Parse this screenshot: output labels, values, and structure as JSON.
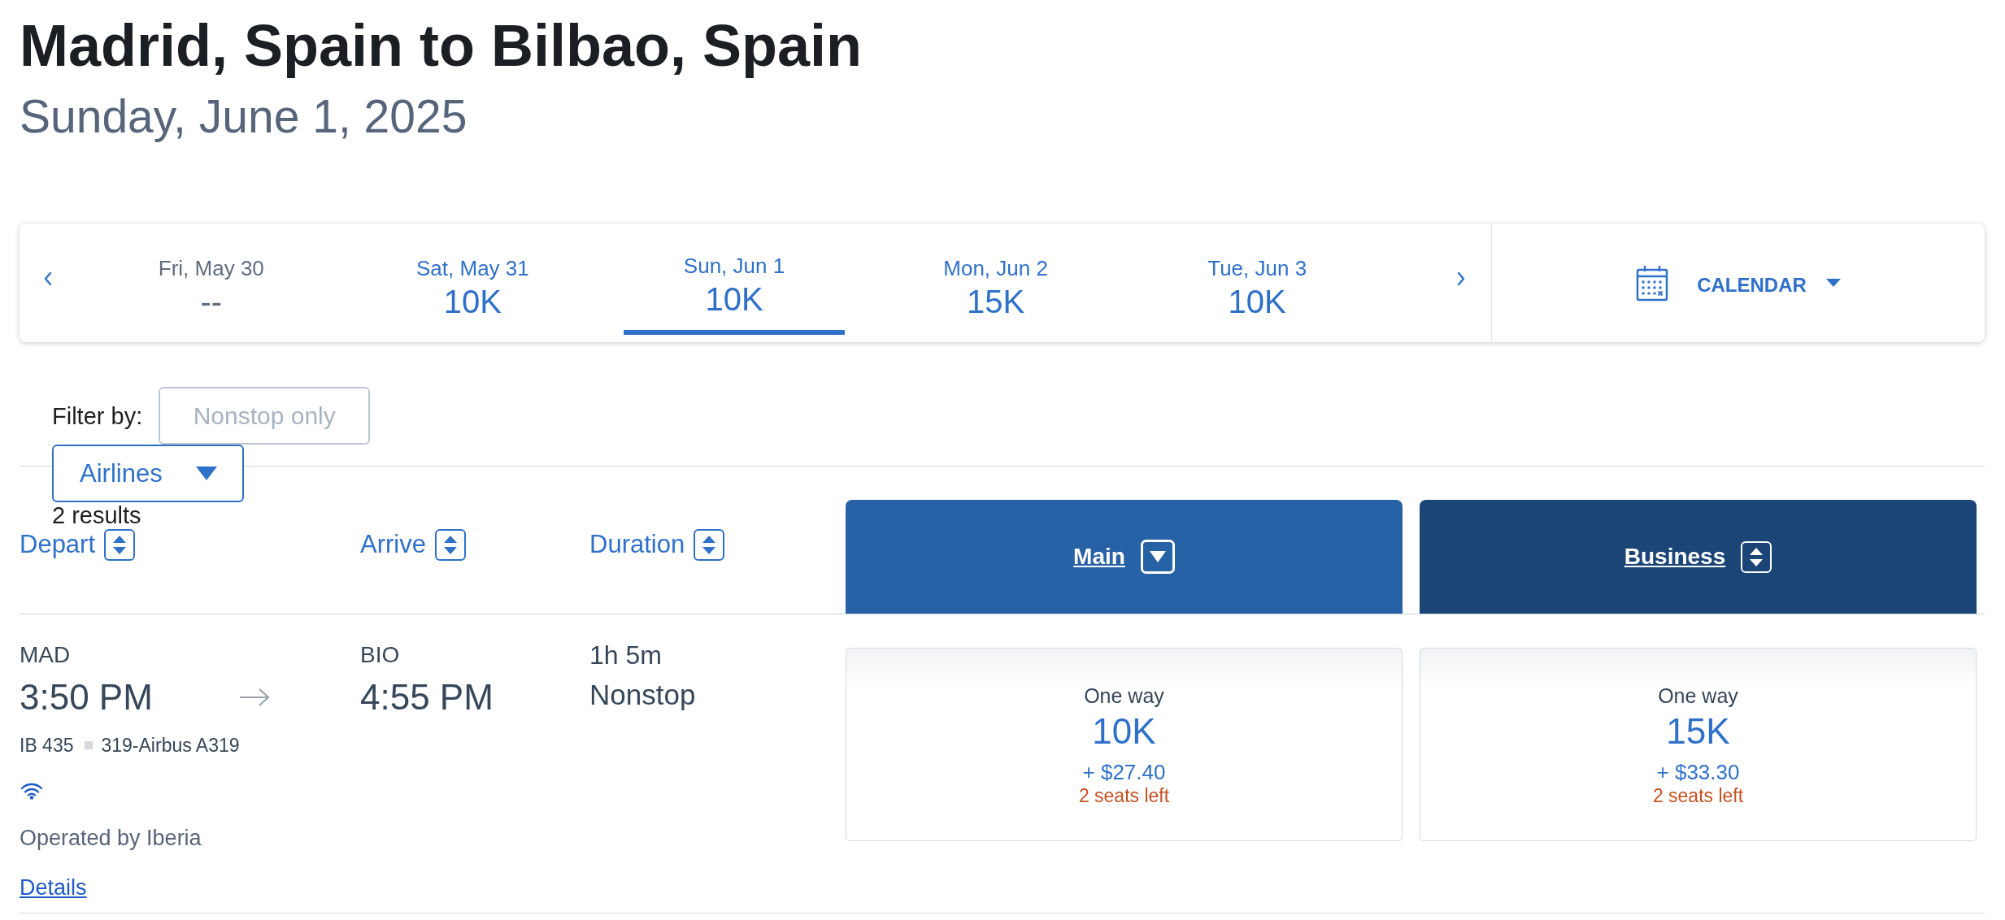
{
  "header": {
    "title": "Madrid, Spain to Bilbao, Spain",
    "subtitle": "Sunday, June 1, 2025"
  },
  "date_strip": {
    "days": [
      {
        "label": "Fri, May 30",
        "price": "--",
        "selected": false,
        "disabled": true
      },
      {
        "label": "Sat, May 31",
        "price": "10K",
        "selected": false,
        "disabled": false
      },
      {
        "label": "Sun, Jun 1",
        "price": "10K",
        "selected": true,
        "disabled": false
      },
      {
        "label": "Mon, Jun 2",
        "price": "15K",
        "selected": false,
        "disabled": false
      },
      {
        "label": "Tue, Jun 3",
        "price": "10K",
        "selected": false,
        "disabled": false
      }
    ],
    "calendar_button": {
      "label": "CALENDAR"
    }
  },
  "filters": {
    "label": "Filter by:",
    "nonstop": {
      "label": "Nonstop only",
      "disabled": true
    },
    "airlines": {
      "label": "Airlines"
    },
    "result_count": "2 results"
  },
  "columns": [
    {
      "label": "Depart"
    },
    {
      "label": "Arrive"
    },
    {
      "label": "Duration"
    }
  ],
  "cabins": [
    {
      "label": "Main",
      "sorted": true
    },
    {
      "label": "Business",
      "sorted": false
    }
  ],
  "flights": [
    {
      "depart": {
        "airport": "MAD",
        "time": "3:50 PM"
      },
      "arrive": {
        "airport": "BIO",
        "time": "4:55 PM"
      },
      "duration": "1h 5m",
      "stops": "Nonstop",
      "flight_number": "IB 435",
      "aircraft": "319-Airbus A319",
      "wifi": true,
      "operated_by": "Operated by Iberia",
      "details_link": "Details",
      "fares": [
        {
          "label": "One way",
          "miles": "10K",
          "taxes": "+ $27.40",
          "seats": "2 seats left"
        },
        {
          "label": "One way",
          "miles": "15K",
          "taxes": "+ $33.30",
          "seats": "2 seats left"
        }
      ]
    }
  ]
}
